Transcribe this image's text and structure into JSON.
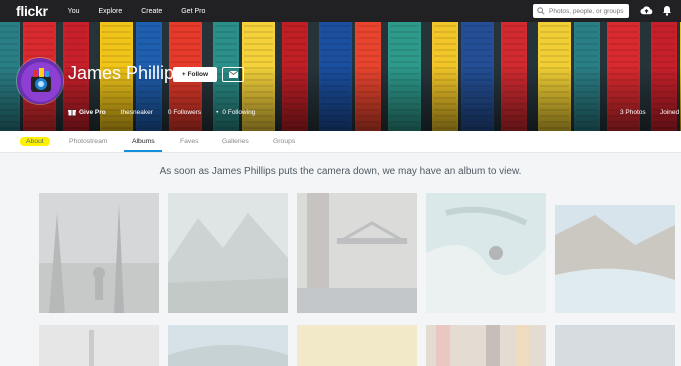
{
  "topbar": {
    "logo": "flickr",
    "nav": [
      "You",
      "Explore",
      "Create",
      "Get Pro"
    ],
    "search_placeholder": "Photos, people, or groups"
  },
  "profile": {
    "name": "James Phillips",
    "follow_label": "+ Follow",
    "give_pro_label": "Give Pro",
    "username": "thesneaker",
    "followers": "0 Followers",
    "following": "0 Following",
    "photos": "3 Photos",
    "joined": "Joined"
  },
  "tabs": {
    "about": "About",
    "photostream": "Photostream",
    "albums": "Albums",
    "faves": "Faves",
    "galleries": "Galleries",
    "groups": "Groups"
  },
  "albums": {
    "empty_message": "As soon as James Phillips puts the camera down, we may have an album to view."
  },
  "colors": {
    "topbar": "#212124",
    "accent": "#128fdc",
    "highlight": "#fff200"
  }
}
